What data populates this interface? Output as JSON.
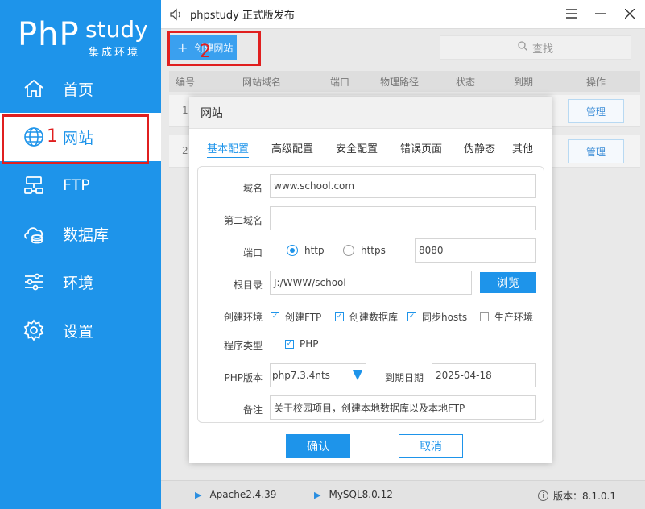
{
  "sidebar": {
    "logo_main": "PhP",
    "logo_study": "study",
    "logo_sub": "集成环境",
    "items": [
      {
        "label": "首页",
        "icon": "home-icon"
      },
      {
        "label": "网站",
        "icon": "globe-icon"
      },
      {
        "label": "FTP",
        "icon": "ftp-icon"
      },
      {
        "label": "数据库",
        "icon": "database-icon"
      },
      {
        "label": "环境",
        "icon": "sliders-icon"
      },
      {
        "label": "设置",
        "icon": "gear-icon"
      }
    ],
    "active_index": 1
  },
  "annotations": {
    "num1": "1",
    "num2": "2",
    "color": "#e01f1f"
  },
  "titlebar": {
    "title": "phpstudy 正式版发布"
  },
  "toolbar": {
    "create_label": "创建网站",
    "search_placeholder": "查找"
  },
  "table": {
    "headers": [
      "编号",
      "网站域名",
      "端口",
      "物理路径",
      "状态",
      "到期",
      "操作"
    ],
    "rows": [
      {
        "index": "1",
        "action": "管理"
      },
      {
        "index": "2",
        "action": "管理"
      }
    ]
  },
  "modal": {
    "title": "网站",
    "tabs": [
      "基本配置",
      "高级配置",
      "安全配置",
      "错误页面",
      "伪静态",
      "其他"
    ],
    "active_tab": 0,
    "domain_label": "域名",
    "domain_value": "www.school.com",
    "second_domain_label": "第二域名",
    "second_domain_value": "",
    "port_label": "端口",
    "port_http": "http",
    "port_https": "https",
    "port_value": "8080",
    "root_label": "根目录",
    "root_value": "J:/WWW/school",
    "browse_label": "浏览",
    "env_label": "创建环境",
    "env_options": [
      {
        "label": "创建FTP",
        "checked": true
      },
      {
        "label": "创建数据库",
        "checked": true
      },
      {
        "label": "同步hosts",
        "checked": true
      },
      {
        "label": "生产环境",
        "checked": false
      }
    ],
    "program_label": "程序类型",
    "program_option": "PHP",
    "php_version_label": "PHP版本",
    "php_version_value": "php7.3.4nts",
    "expire_label": "到期日期",
    "expire_value": "2025-04-18",
    "remark_label": "备注",
    "remark_value": "关于校园项目，创建本地数据库以及本地FTP",
    "ok_label": "确认",
    "cancel_label": "取消"
  },
  "statusbar": {
    "apache": "Apache2.4.39",
    "mysql": "MySQL8.0.12",
    "version": "版本：8.1.0.1"
  },
  "colors": {
    "brand": "#1e94ea",
    "highlight": "#e01f1f"
  }
}
